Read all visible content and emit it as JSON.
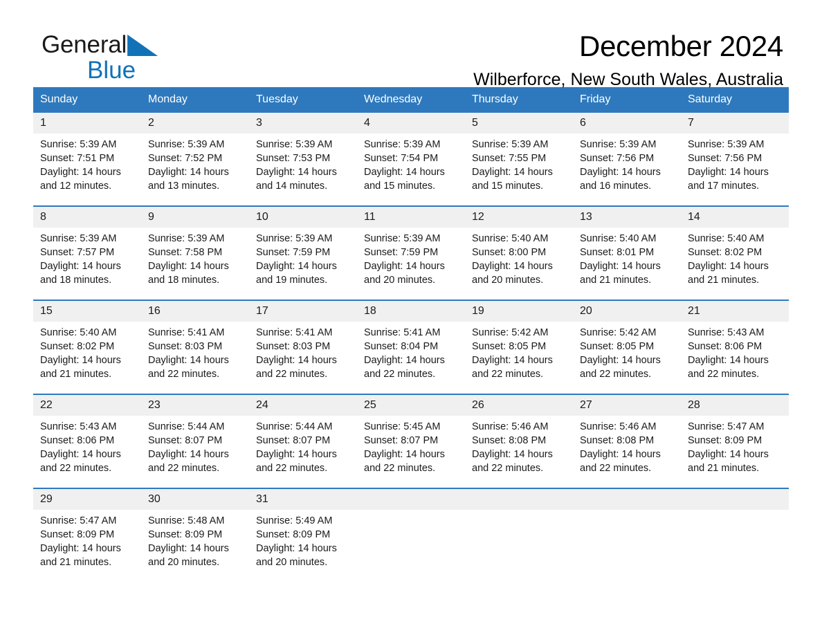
{
  "brand": {
    "name_part1": "General",
    "name_part2": "Blue",
    "triangle_color": "#1272b8"
  },
  "header": {
    "title": "December 2024",
    "subtitle": "Wilberforce, New South Wales, Australia",
    "accent_color": "#2e79bd"
  },
  "weekdays": [
    "Sunday",
    "Monday",
    "Tuesday",
    "Wednesday",
    "Thursday",
    "Friday",
    "Saturday"
  ],
  "weeks": [
    [
      {
        "day": "1",
        "sunrise": "Sunrise: 5:39 AM",
        "sunset": "Sunset: 7:51 PM",
        "daylight_line1": "Daylight: 14 hours",
        "daylight_line2": "and 12 minutes."
      },
      {
        "day": "2",
        "sunrise": "Sunrise: 5:39 AM",
        "sunset": "Sunset: 7:52 PM",
        "daylight_line1": "Daylight: 14 hours",
        "daylight_line2": "and 13 minutes."
      },
      {
        "day": "3",
        "sunrise": "Sunrise: 5:39 AM",
        "sunset": "Sunset: 7:53 PM",
        "daylight_line1": "Daylight: 14 hours",
        "daylight_line2": "and 14 minutes."
      },
      {
        "day": "4",
        "sunrise": "Sunrise: 5:39 AM",
        "sunset": "Sunset: 7:54 PM",
        "daylight_line1": "Daylight: 14 hours",
        "daylight_line2": "and 15 minutes."
      },
      {
        "day": "5",
        "sunrise": "Sunrise: 5:39 AM",
        "sunset": "Sunset: 7:55 PM",
        "daylight_line1": "Daylight: 14 hours",
        "daylight_line2": "and 15 minutes."
      },
      {
        "day": "6",
        "sunrise": "Sunrise: 5:39 AM",
        "sunset": "Sunset: 7:56 PM",
        "daylight_line1": "Daylight: 14 hours",
        "daylight_line2": "and 16 minutes."
      },
      {
        "day": "7",
        "sunrise": "Sunrise: 5:39 AM",
        "sunset": "Sunset: 7:56 PM",
        "daylight_line1": "Daylight: 14 hours",
        "daylight_line2": "and 17 minutes."
      }
    ],
    [
      {
        "day": "8",
        "sunrise": "Sunrise: 5:39 AM",
        "sunset": "Sunset: 7:57 PM",
        "daylight_line1": "Daylight: 14 hours",
        "daylight_line2": "and 18 minutes."
      },
      {
        "day": "9",
        "sunrise": "Sunrise: 5:39 AM",
        "sunset": "Sunset: 7:58 PM",
        "daylight_line1": "Daylight: 14 hours",
        "daylight_line2": "and 18 minutes."
      },
      {
        "day": "10",
        "sunrise": "Sunrise: 5:39 AM",
        "sunset": "Sunset: 7:59 PM",
        "daylight_line1": "Daylight: 14 hours",
        "daylight_line2": "and 19 minutes."
      },
      {
        "day": "11",
        "sunrise": "Sunrise: 5:39 AM",
        "sunset": "Sunset: 7:59 PM",
        "daylight_line1": "Daylight: 14 hours",
        "daylight_line2": "and 20 minutes."
      },
      {
        "day": "12",
        "sunrise": "Sunrise: 5:40 AM",
        "sunset": "Sunset: 8:00 PM",
        "daylight_line1": "Daylight: 14 hours",
        "daylight_line2": "and 20 minutes."
      },
      {
        "day": "13",
        "sunrise": "Sunrise: 5:40 AM",
        "sunset": "Sunset: 8:01 PM",
        "daylight_line1": "Daylight: 14 hours",
        "daylight_line2": "and 21 minutes."
      },
      {
        "day": "14",
        "sunrise": "Sunrise: 5:40 AM",
        "sunset": "Sunset: 8:02 PM",
        "daylight_line1": "Daylight: 14 hours",
        "daylight_line2": "and 21 minutes."
      }
    ],
    [
      {
        "day": "15",
        "sunrise": "Sunrise: 5:40 AM",
        "sunset": "Sunset: 8:02 PM",
        "daylight_line1": "Daylight: 14 hours",
        "daylight_line2": "and 21 minutes."
      },
      {
        "day": "16",
        "sunrise": "Sunrise: 5:41 AM",
        "sunset": "Sunset: 8:03 PM",
        "daylight_line1": "Daylight: 14 hours",
        "daylight_line2": "and 22 minutes."
      },
      {
        "day": "17",
        "sunrise": "Sunrise: 5:41 AM",
        "sunset": "Sunset: 8:03 PM",
        "daylight_line1": "Daylight: 14 hours",
        "daylight_line2": "and 22 minutes."
      },
      {
        "day": "18",
        "sunrise": "Sunrise: 5:41 AM",
        "sunset": "Sunset: 8:04 PM",
        "daylight_line1": "Daylight: 14 hours",
        "daylight_line2": "and 22 minutes."
      },
      {
        "day": "19",
        "sunrise": "Sunrise: 5:42 AM",
        "sunset": "Sunset: 8:05 PM",
        "daylight_line1": "Daylight: 14 hours",
        "daylight_line2": "and 22 minutes."
      },
      {
        "day": "20",
        "sunrise": "Sunrise: 5:42 AM",
        "sunset": "Sunset: 8:05 PM",
        "daylight_line1": "Daylight: 14 hours",
        "daylight_line2": "and 22 minutes."
      },
      {
        "day": "21",
        "sunrise": "Sunrise: 5:43 AM",
        "sunset": "Sunset: 8:06 PM",
        "daylight_line1": "Daylight: 14 hours",
        "daylight_line2": "and 22 minutes."
      }
    ],
    [
      {
        "day": "22",
        "sunrise": "Sunrise: 5:43 AM",
        "sunset": "Sunset: 8:06 PM",
        "daylight_line1": "Daylight: 14 hours",
        "daylight_line2": "and 22 minutes."
      },
      {
        "day": "23",
        "sunrise": "Sunrise: 5:44 AM",
        "sunset": "Sunset: 8:07 PM",
        "daylight_line1": "Daylight: 14 hours",
        "daylight_line2": "and 22 minutes."
      },
      {
        "day": "24",
        "sunrise": "Sunrise: 5:44 AM",
        "sunset": "Sunset: 8:07 PM",
        "daylight_line1": "Daylight: 14 hours",
        "daylight_line2": "and 22 minutes."
      },
      {
        "day": "25",
        "sunrise": "Sunrise: 5:45 AM",
        "sunset": "Sunset: 8:07 PM",
        "daylight_line1": "Daylight: 14 hours",
        "daylight_line2": "and 22 minutes."
      },
      {
        "day": "26",
        "sunrise": "Sunrise: 5:46 AM",
        "sunset": "Sunset: 8:08 PM",
        "daylight_line1": "Daylight: 14 hours",
        "daylight_line2": "and 22 minutes."
      },
      {
        "day": "27",
        "sunrise": "Sunrise: 5:46 AM",
        "sunset": "Sunset: 8:08 PM",
        "daylight_line1": "Daylight: 14 hours",
        "daylight_line2": "and 22 minutes."
      },
      {
        "day": "28",
        "sunrise": "Sunrise: 5:47 AM",
        "sunset": "Sunset: 8:09 PM",
        "daylight_line1": "Daylight: 14 hours",
        "daylight_line2": "and 21 minutes."
      }
    ],
    [
      {
        "day": "29",
        "sunrise": "Sunrise: 5:47 AM",
        "sunset": "Sunset: 8:09 PM",
        "daylight_line1": "Daylight: 14 hours",
        "daylight_line2": "and 21 minutes."
      },
      {
        "day": "30",
        "sunrise": "Sunrise: 5:48 AM",
        "sunset": "Sunset: 8:09 PM",
        "daylight_line1": "Daylight: 14 hours",
        "daylight_line2": "and 20 minutes."
      },
      {
        "day": "31",
        "sunrise": "Sunrise: 5:49 AM",
        "sunset": "Sunset: 8:09 PM",
        "daylight_line1": "Daylight: 14 hours",
        "daylight_line2": "and 20 minutes."
      },
      {
        "day": "",
        "sunrise": "",
        "sunset": "",
        "daylight_line1": "",
        "daylight_line2": ""
      },
      {
        "day": "",
        "sunrise": "",
        "sunset": "",
        "daylight_line1": "",
        "daylight_line2": ""
      },
      {
        "day": "",
        "sunrise": "",
        "sunset": "",
        "daylight_line1": "",
        "daylight_line2": ""
      },
      {
        "day": "",
        "sunrise": "",
        "sunset": "",
        "daylight_line1": "",
        "daylight_line2": ""
      }
    ]
  ]
}
